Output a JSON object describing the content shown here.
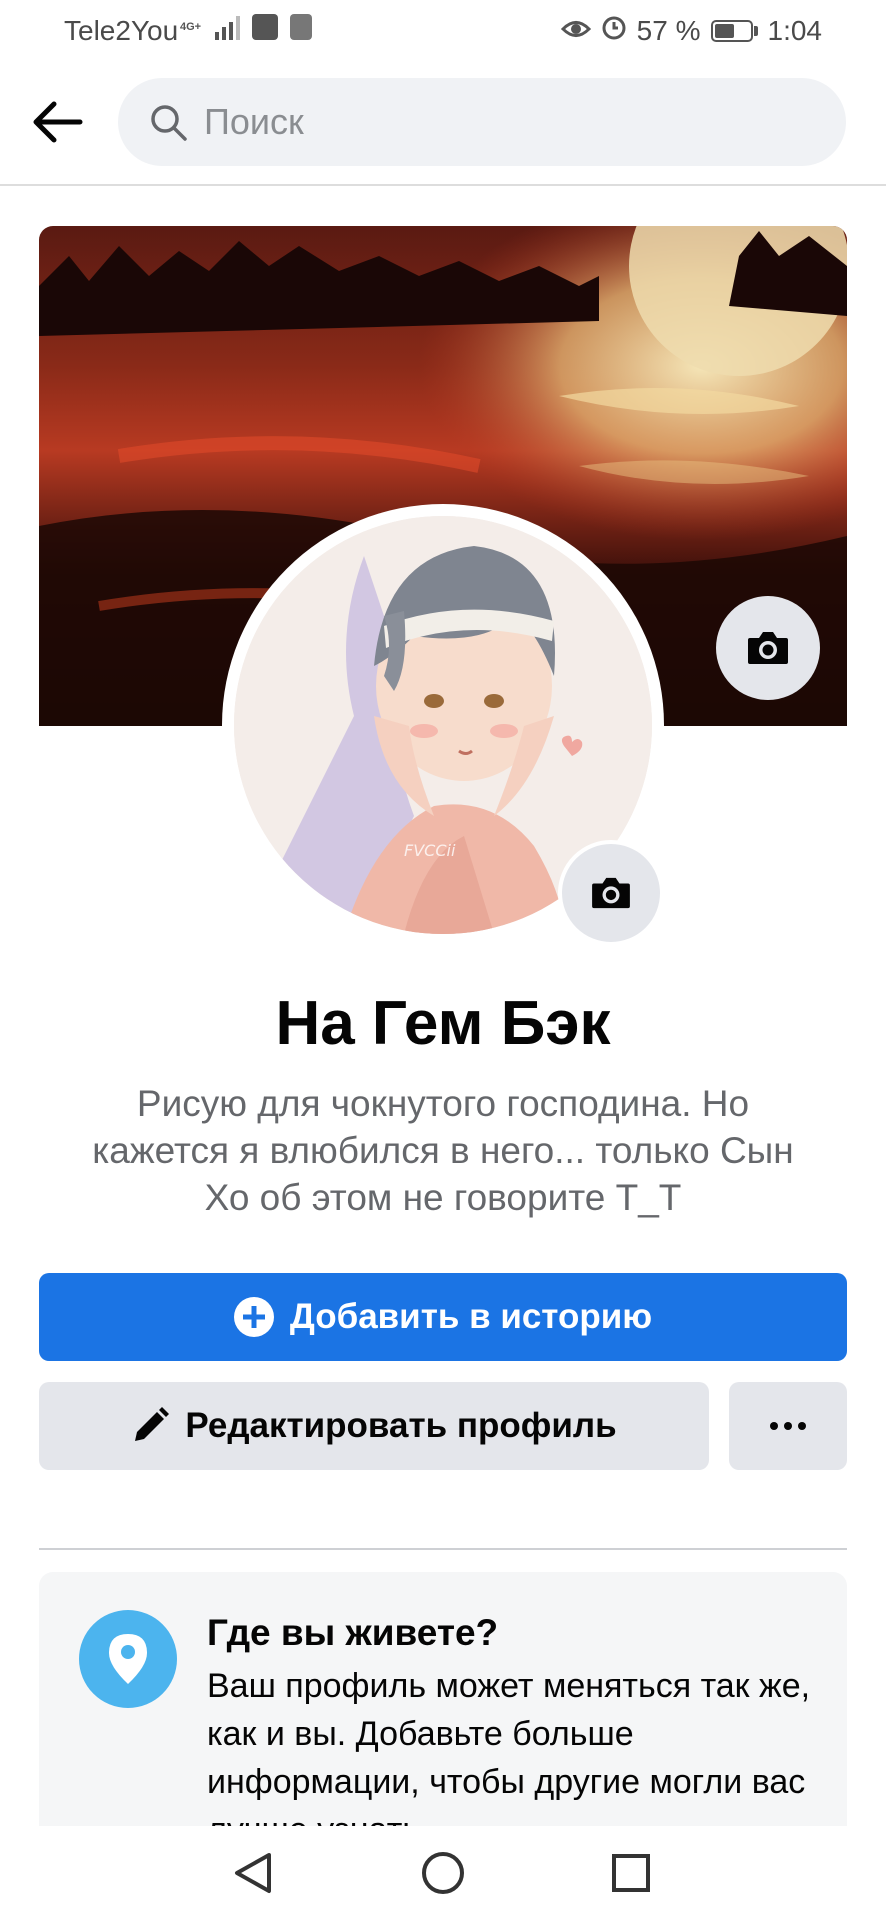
{
  "status_bar": {
    "carrier": "Tele2You",
    "network": "4G+",
    "battery_percent": "57 %",
    "battery_level": 0.57,
    "time": "1:04"
  },
  "header": {
    "back_icon": "arrow-left-icon",
    "search_placeholder": "Поиск"
  },
  "profile": {
    "name": "На Гем Бэк",
    "bio": "Рисую для чокнутого господина. Но кажется  я влюбился в него... только Сын Хо об этом не говорите Т_Т",
    "avatar_watermark": "FVCCii"
  },
  "actions": {
    "add_story_label": "Добавить в историю",
    "edit_profile_label": "Редактировать профиль"
  },
  "location_card": {
    "title": "Где вы живете?",
    "text": "Ваш профиль может меняться так же, как и вы. Добавьте больше информации, чтобы другие могли вас лучше узнать."
  },
  "colors": {
    "primary": "#1b74e4",
    "secondary_button": "#e4e6eb",
    "pin_circle": "#4cb4ee",
    "bio_text": "#65676b"
  }
}
